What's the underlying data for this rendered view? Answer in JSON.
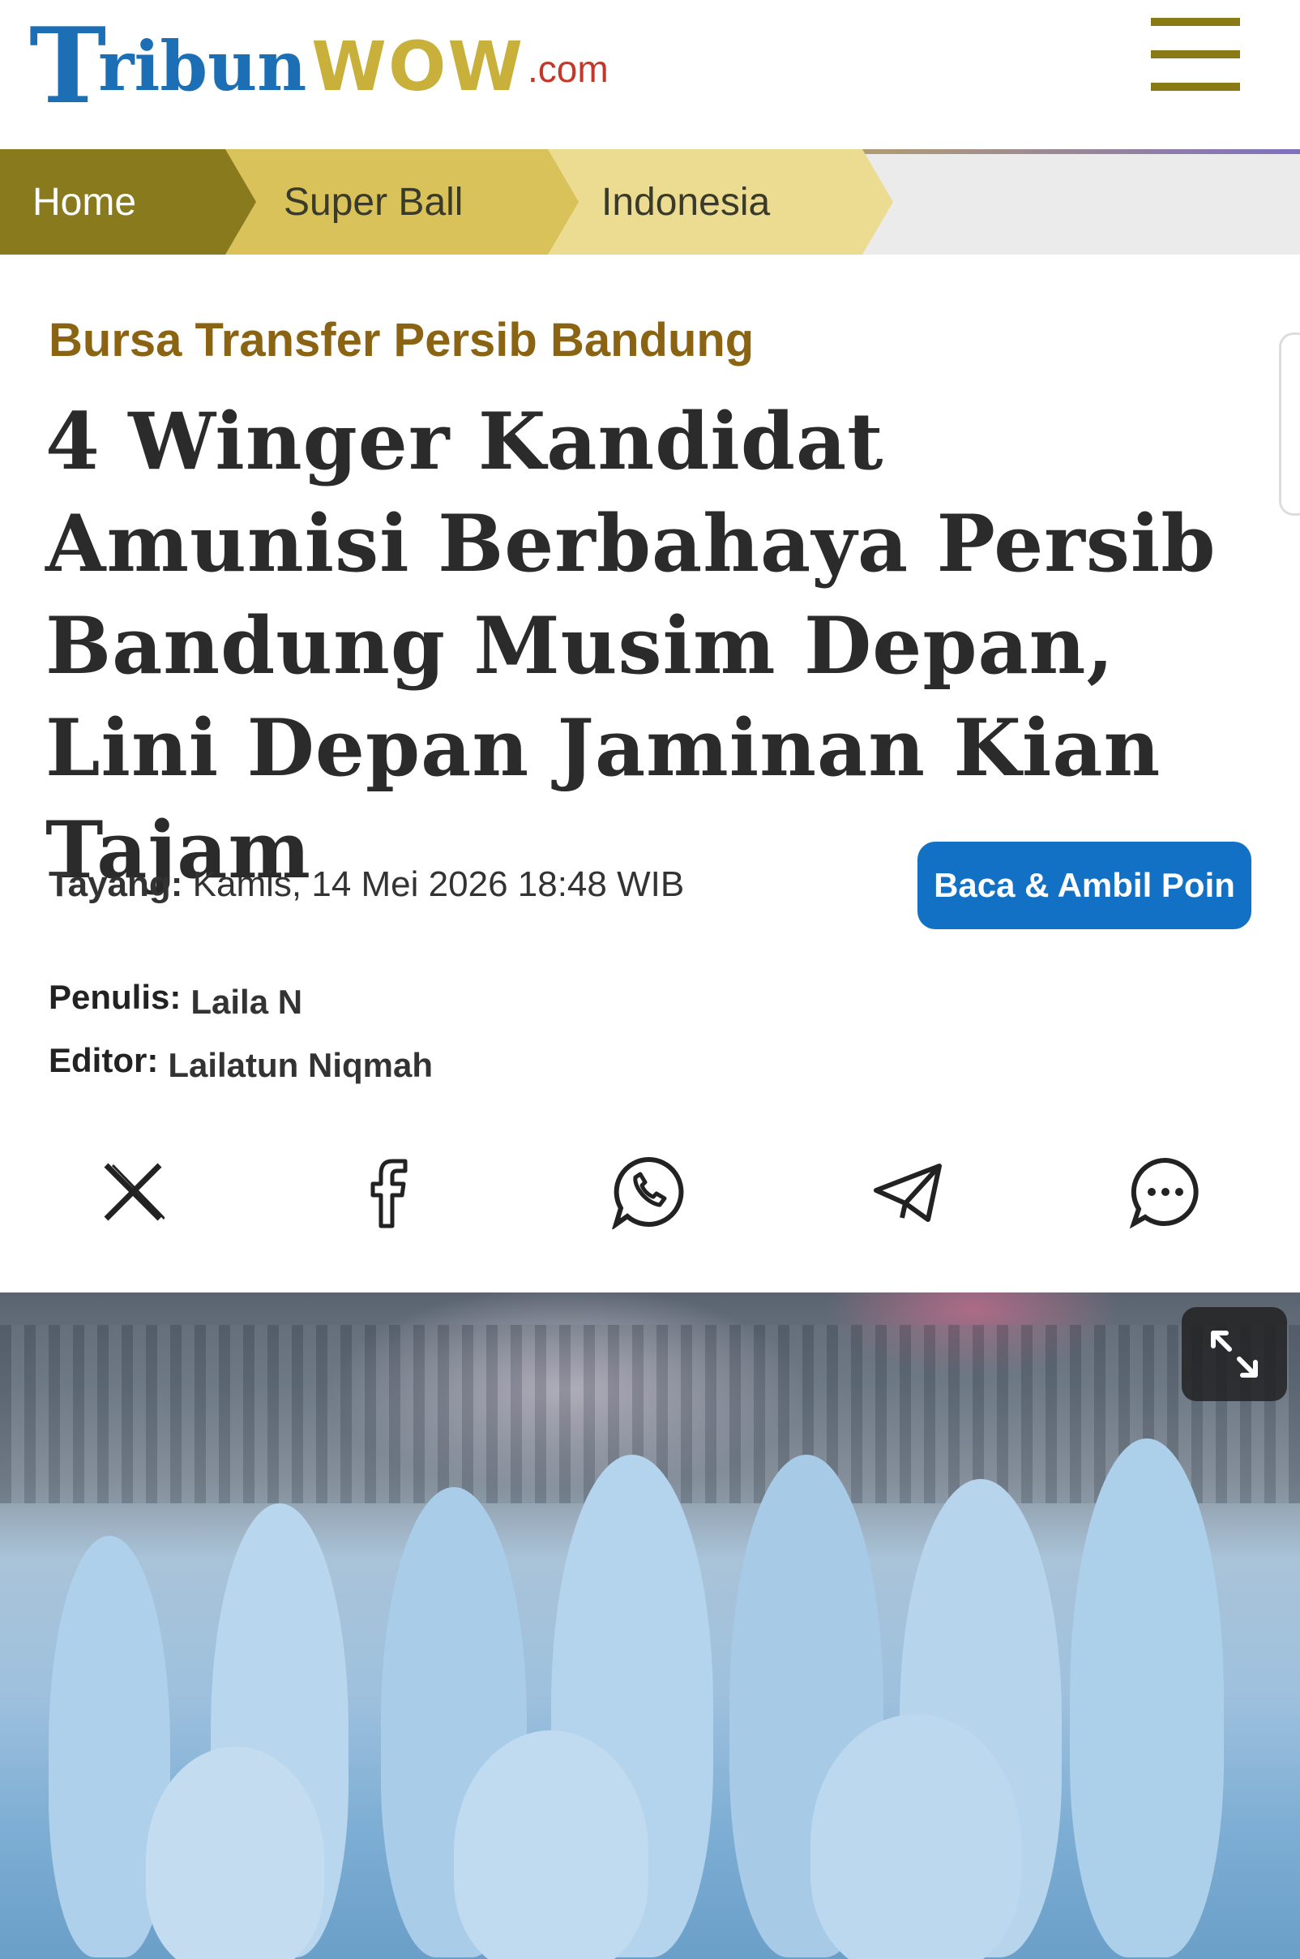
{
  "header": {
    "logo_t": "T",
    "logo_ribun": "ribun",
    "logo_wow": "WOW",
    "logo_com": ".com",
    "menu_icon": "hamburger-icon",
    "accent_color": "#8a7a16"
  },
  "breadcrumb": {
    "items": [
      {
        "label": "Home"
      },
      {
        "label": "Super Ball"
      },
      {
        "label": "Indonesia"
      }
    ]
  },
  "article": {
    "category": "Bursa Transfer Persib Bandung",
    "title": "4 Winger Kandidat Amunisi Berbahaya Persib Bandung Musim Depan, Lini Depan Jaminan Kian Tajam",
    "publish_label": "Tayang:",
    "publish_date": "Kamis, 14 Mei 2026 18:48 WIB",
    "cta_label": "Baca & Ambil Poin",
    "author_label": "Penulis:",
    "author": "Laila N",
    "editor_label": "Editor:",
    "editor": "Lailatun Niqmah",
    "category_color": "#8a6412",
    "cta_color": "#1271c4"
  },
  "share": {
    "icons": [
      "x-icon",
      "facebook-icon",
      "whatsapp-icon",
      "telegram-icon",
      "comment-icon"
    ]
  },
  "hero": {
    "expand_icon": "expand-icon"
  }
}
